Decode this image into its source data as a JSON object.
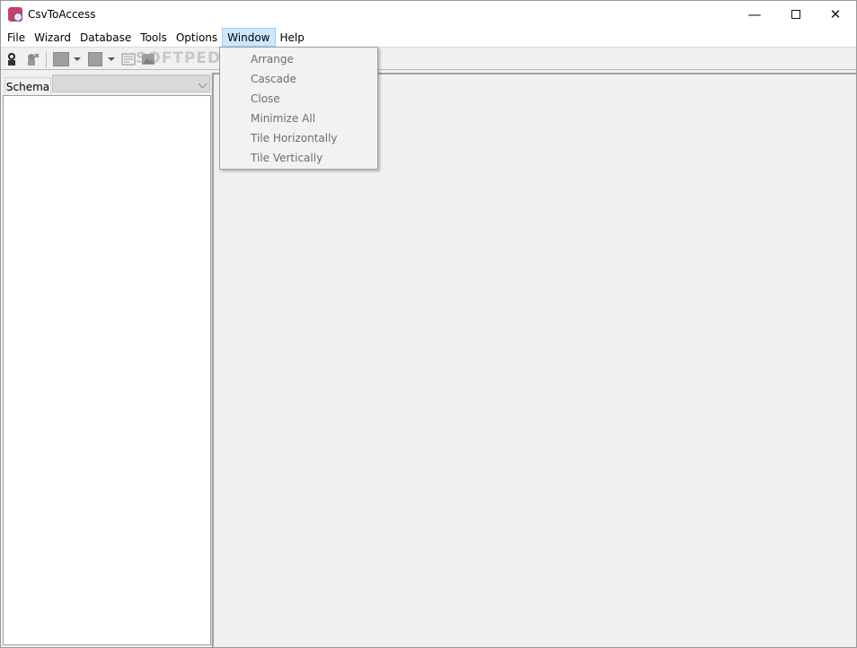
{
  "window": {
    "title": "CsvToAccess",
    "minimize_glyph": "—",
    "close_glyph": "✕"
  },
  "menubar": {
    "items": [
      "File",
      "Wizard",
      "Database",
      "Tools",
      "Options",
      "Window",
      "Help"
    ],
    "active_item": "Window"
  },
  "toolbar": {
    "watermark": "SOFTPEDIA",
    "icons": [
      "connect-icon",
      "disconnect-icon",
      "table-icon",
      "import-icon",
      "query-icon",
      "image-icon"
    ]
  },
  "left_panel": {
    "tab_label": "Schema",
    "combo_value": ""
  },
  "window_menu": {
    "items": [
      "Arrange",
      "Cascade",
      "Close",
      "Minimize All",
      "Tile Horizontally",
      "Tile Vertically"
    ],
    "all_disabled": true
  },
  "colors": {
    "menu_highlight": "#cce8ff",
    "disabled_text": "#6d6d6d",
    "app_icon": "#c2406a"
  }
}
